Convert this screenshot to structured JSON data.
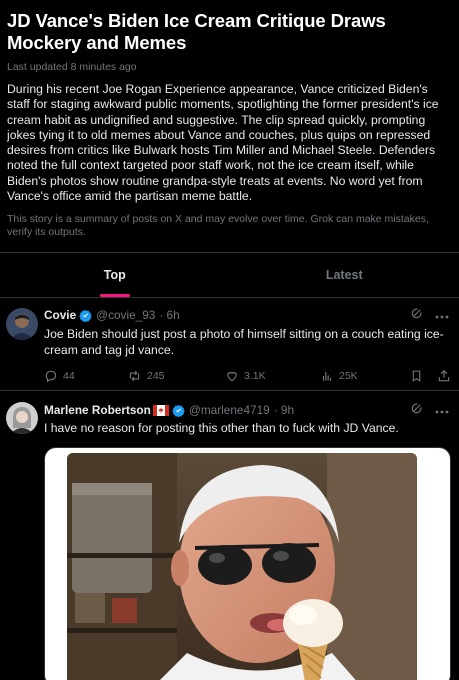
{
  "story": {
    "title": "JD Vance's Biden Ice Cream Critique Draws Mockery and Memes",
    "updated": "Last updated 8 minutes ago",
    "summary": "During his recent Joe Rogan Experience appearance, Vance criticized Biden's staff for staging awkward public moments, spotlighting the former president's ice cream habit as undignified and suggestive. The clip spread quickly, prompting jokes tying it to old memes about Vance and couches, plus quips on repressed desires from critics like Bulwark hosts Tim Miller and Michael Steele. Defenders noted the full context targeted poor staff work, not the ice cream itself, while Biden's photos show routine grandpa-style treats at events. No word yet from Vance's office amid the partisan meme battle.",
    "disclaimer": "This story is a summary of posts on X and may evolve over time. Grok can make mistakes, verify its outputs."
  },
  "tabs": [
    {
      "label": "Top",
      "active": true
    },
    {
      "label": "Latest",
      "active": false
    }
  ],
  "posts": [
    {
      "name": "Covie",
      "handle": "@covie_93",
      "time": "· 6h",
      "text": "Joe Biden should just post a photo of himself sitting on a couch eating ice-cream and tag jd vance.",
      "replies": "44",
      "reposts": "245",
      "likes": "3.1K",
      "views": "25K"
    },
    {
      "name": "Marlene Robertson",
      "handle": "@marlene4719",
      "time": "· 9h",
      "text": "I have no reason for posting this other than to fuck with JD Vance."
    }
  ],
  "colors": {
    "accent": "#f91880",
    "verified": "#1d9bf0",
    "muted": "#71767b",
    "background": "#000000"
  },
  "icons": [
    "grok-icon",
    "more-icon",
    "reply-icon",
    "repost-icon",
    "like-icon",
    "views-icon",
    "bookmark-icon",
    "share-icon",
    "verified-badge-icon",
    "canada-flag-icon"
  ]
}
